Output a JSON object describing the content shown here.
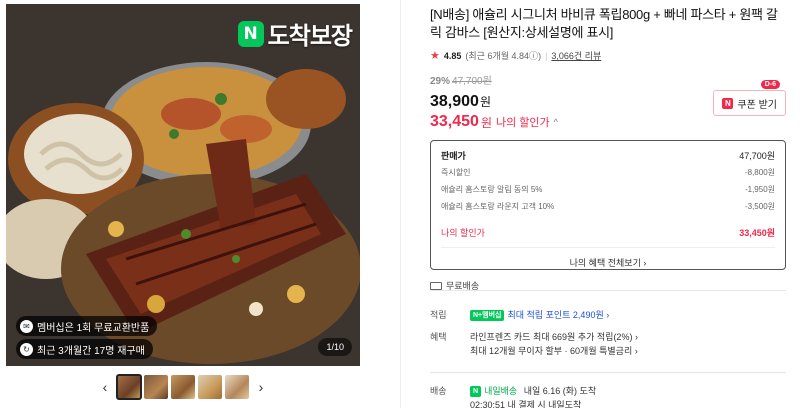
{
  "gallery": {
    "badge": {
      "n": "N",
      "text": "도착보장"
    },
    "tags": [
      {
        "icon": "coupon-icon",
        "text": "멤버십은 1회 무료교환반품"
      },
      {
        "icon": "repurchase-icon",
        "text": "최근 3개월간 17명 재구매"
      }
    ],
    "counter": "1/10",
    "prev_arrow": "‹",
    "next_arrow": "›"
  },
  "product": {
    "title": "[N배송] 애슐리 시그니처 바비큐 폭립800g + 빠네 파스타 + 원팩 갈릭 감바스 [원산지:상세설명에 표시]",
    "rating": "4.85",
    "rating_recent": "(최근 6개월 4.84",
    "info_icon": "ⓘ",
    "rating_close": ")",
    "review_count": "3,066건 리뷰",
    "discount_rate": "29%",
    "original_price": "47,700원",
    "sale_price": "38,900",
    "won": "원",
    "my_price": "33,450",
    "my_price_label": "나의 할인가",
    "coupon": {
      "dday": "D-6",
      "n": "N",
      "label": "쿠폰 받기"
    }
  },
  "price_box": {
    "rows": [
      {
        "label": "판매가",
        "value": "47,700원"
      },
      {
        "label": "즉시할인",
        "value": "-8,800원"
      },
      {
        "label": "애슐리 홈스토랑 알림 동의 5%",
        "value": "-1,950원"
      },
      {
        "label": "애슐리 홈스토랑 라운지 고객 10%",
        "value": "-3,500원"
      }
    ],
    "total_label": "나의 할인가",
    "total_value": "33,450원",
    "more": "나의 혜택 전체보기 ›"
  },
  "shipping": {
    "text": "무료배송"
  },
  "points": {
    "label": "적립",
    "badge": "N+멤버십",
    "text": "최대 적립 포인트 2,490원 ›"
  },
  "benefits": {
    "label": "혜택",
    "line1": "라인프렌즈 카드 최대 669원 추가 적립(2%) ›",
    "line2": "최대 12개월 무이자 할부 · 60개월 특별금리 ›"
  },
  "delivery": {
    "label": "배송",
    "badge": "N",
    "type": "내일배송",
    "arrive": "내일 6.16 (화) 도착",
    "line2": "02:30:51 내 결제 시 내일도착"
  },
  "colors": {
    "accent": "#f0284a",
    "naver_green": "#03c75a",
    "link": "#1a4fd6"
  }
}
